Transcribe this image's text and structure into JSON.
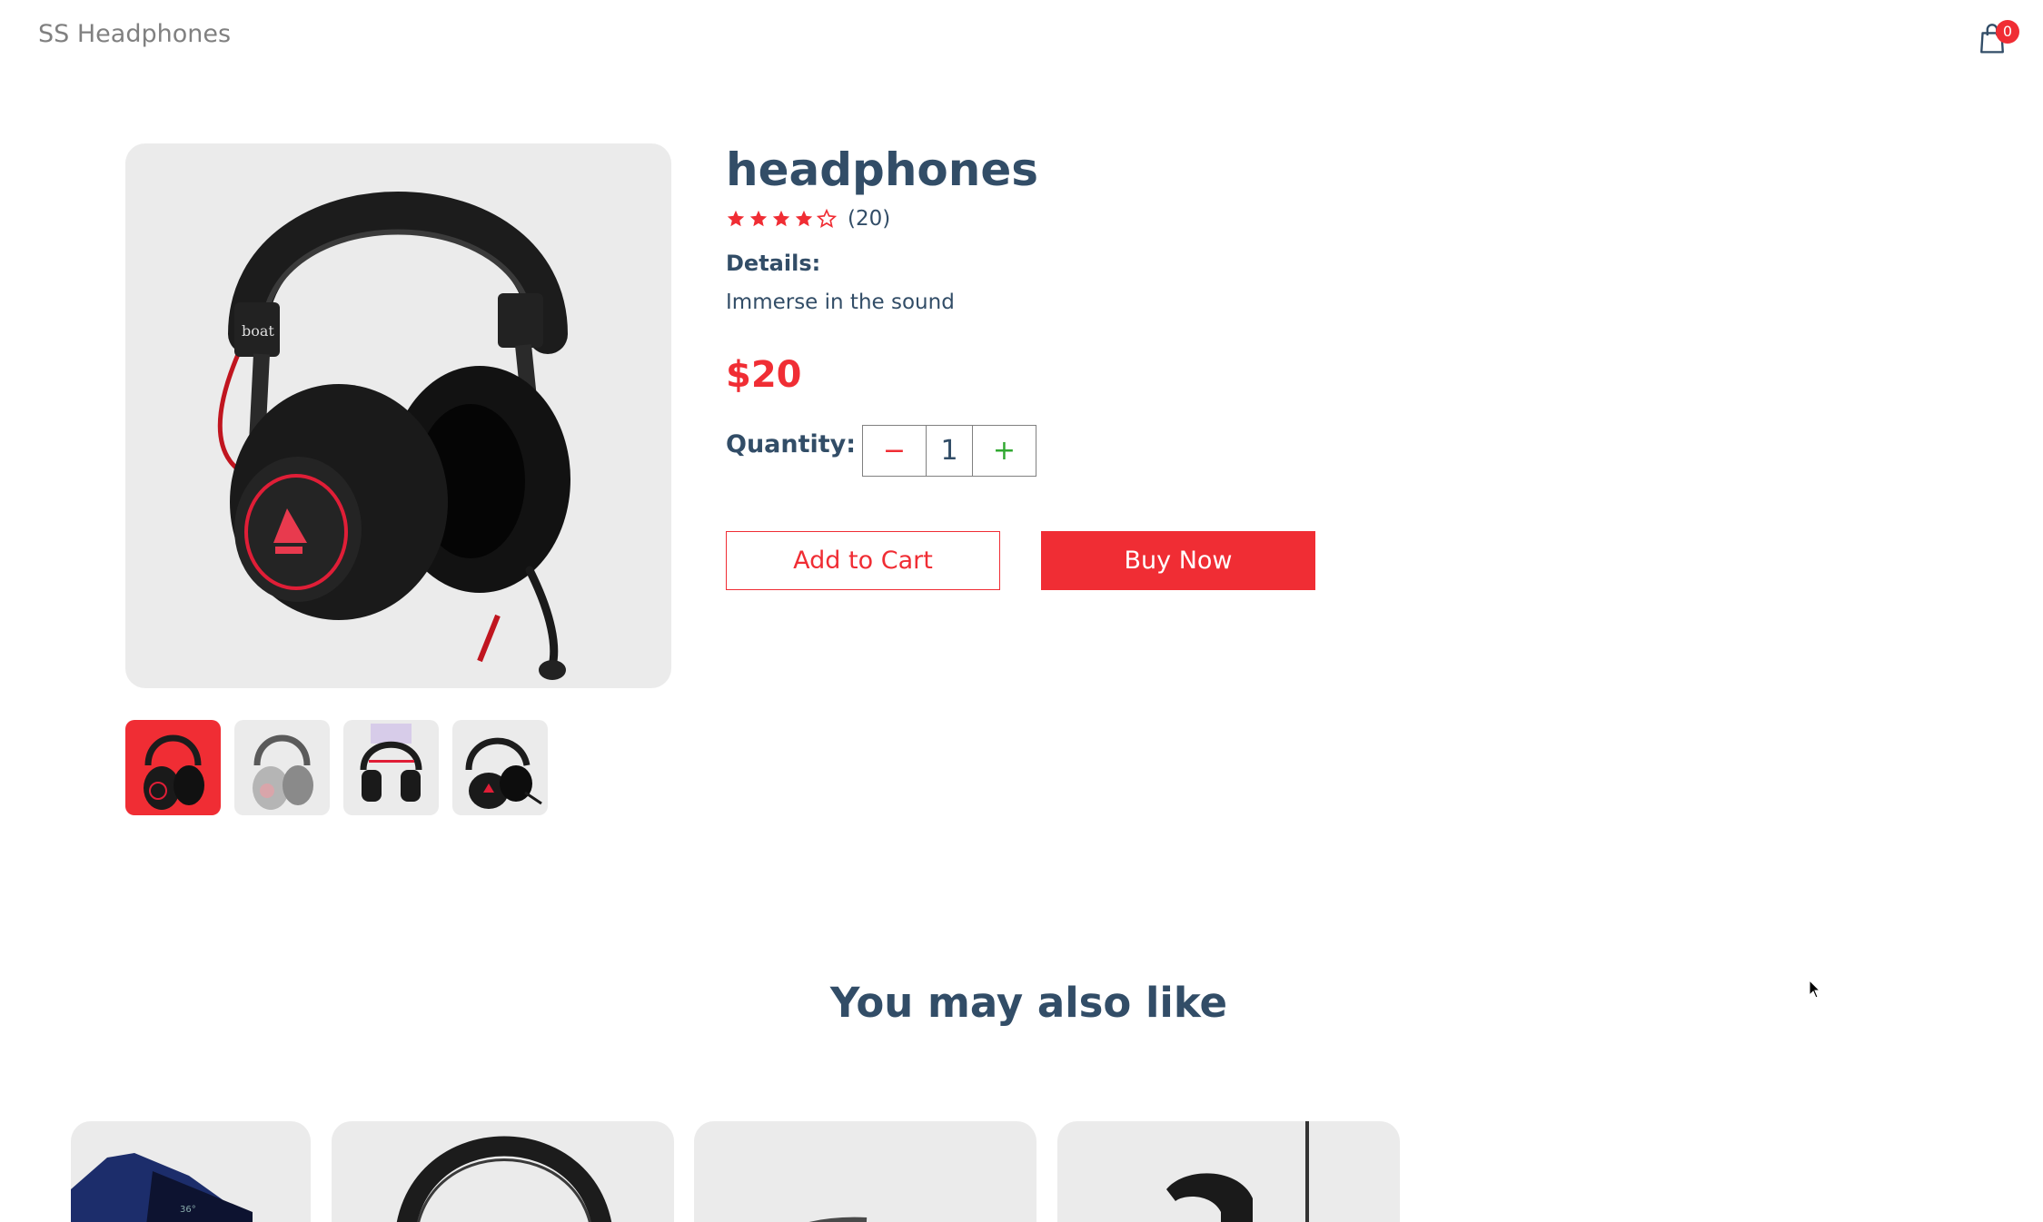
{
  "navbar": {
    "logo": "SS Headphones",
    "cart_count": "0"
  },
  "product": {
    "name": "headphones",
    "rating_stars": 4,
    "review_count": "(20)",
    "details_heading": "Details:",
    "details_text": "Immerse in the sound",
    "price": "$20",
    "quantity_label": "Quantity:",
    "quantity": "1",
    "minus_symbol": "−",
    "plus_symbol": "+",
    "selected_thumbnail": 1,
    "thumbnails": [
      "headphone-red-black",
      "headphone-silver",
      "headphone-black-rgb",
      "headphone-black-red"
    ]
  },
  "actions": {
    "add_to_cart": "Add to Cart",
    "buy_now": "Buy Now"
  },
  "section": {
    "title": "You may also like"
  },
  "recommendations": [
    "smartwatch-blue",
    "headphone-black",
    "speaker-grey",
    "earphone-black-red"
  ],
  "colors": {
    "accent": "#f02d34",
    "text": "#324d67",
    "card_bg": "#ebebeb",
    "plus": "#31a831"
  }
}
